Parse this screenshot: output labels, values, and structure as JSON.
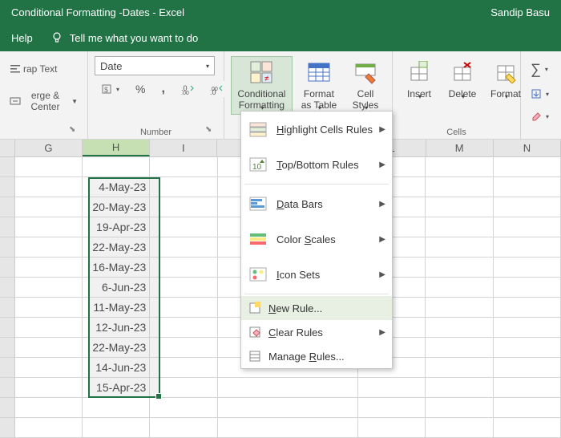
{
  "titlebar": {
    "title": "Conditional Formatting -Dates  -  Excel",
    "user": "Sandip Basu"
  },
  "tellme": {
    "help": "Help",
    "placeholder": "Tell me what you want to do"
  },
  "ribbon": {
    "alignment": {
      "wrap": "rap Text",
      "merge": "erge & Center"
    },
    "number": {
      "format": "Date",
      "group_label": "Number"
    },
    "styles": {
      "conditional": "Conditional Formatting",
      "format_table": "Format as Table",
      "cell_styles": "Cell Styles"
    },
    "cells": {
      "insert": "Insert",
      "delete": "Delete",
      "format": "Format",
      "group_label": "Cells"
    }
  },
  "cf_menu": {
    "highlight": "Highlight Cells Rules",
    "topbottom": "Top/Bottom Rules",
    "databars": "Data Bars",
    "colorscales": "Color Scales",
    "iconsets": "Icon Sets",
    "new_rule": "New Rule...",
    "clear": "Clear Rules",
    "manage": "Manage Rules..."
  },
  "columns": [
    "G",
    "H",
    "I",
    "",
    "L",
    "M",
    "N"
  ],
  "data": {
    "H": [
      "",
      "4-May-23",
      "20-May-23",
      "19-Apr-23",
      "22-May-23",
      "16-May-23",
      "6-Jun-23",
      "11-May-23",
      "12-Jun-23",
      "22-May-23",
      "14-Jun-23",
      "15-Apr-23"
    ]
  }
}
